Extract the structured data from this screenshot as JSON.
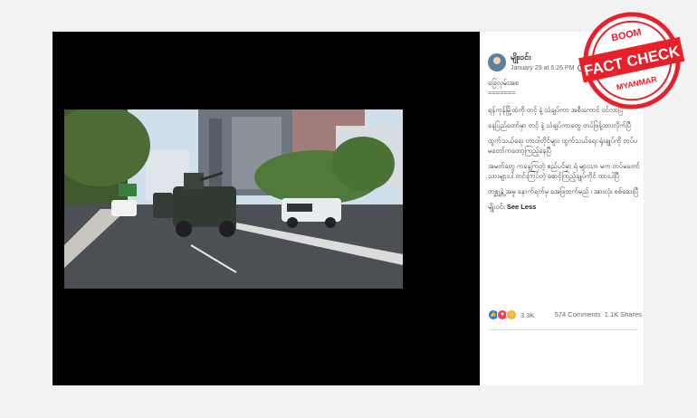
{
  "post": {
    "author": "မျိုးဝင်း",
    "timestamp": "January 29 at 6:26 PM",
    "more_icon": "ellipsis-icon",
    "paragraphs": [
      "ခြေလှမ်းအစ",
      "=======",
      "ရန်ကုန်မြို့ထဲကို တင့် နဲ့ သံချပ်ကာ အစီးကောင် ဝင်လာပြီ",
      "နေပြည်တော်မှာ တင့် နဲ့ သံချပ်ကာတွေ တပ်ဖြန့်ထားလိုက်ပြီ",
      "ထွက်သယ်ရေး တာဝါတိုင်များ ထွက်သယ်ရေး ရုံးချုပ်ကို တပ်ပမတော်ကတော့ကြည့်နေပြီ",
      "အမတ်တွေ ကနေ့ကြတဲ့ စည်ပင်မှာ ရဲ များသာ မက တပ်မတော်သားများပါ တင်းကြပ်တဲ့ စောင့်ကြည့်ချုပ်ကိုင် ထားပါပြီ",
      "တစ္ချန္တဲ့ အမှု နောက်ရက်မှ အေဖြထက်မည် ၊ အားလုံး စစ်ဆေးပြီ"
    ],
    "signoff": "မျိုးဝင်း",
    "see_less": "See Less",
    "reaction_count": "3.3K",
    "comments": "574 Comments",
    "shares": "1.1K Shares"
  },
  "stamp": {
    "top": "BOOM",
    "main": "FACT CHECK",
    "bottom": "MYANMAR",
    "color": "#e8202a"
  },
  "colors": {
    "panel_bg": "#000000",
    "accent": "#1877f2"
  }
}
